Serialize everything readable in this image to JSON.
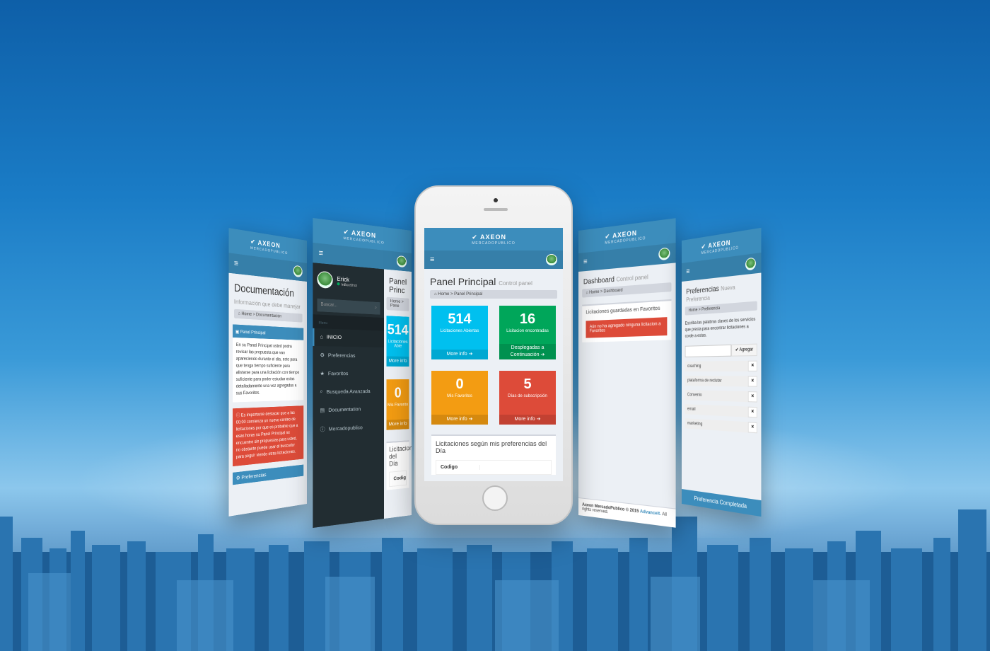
{
  "brand": {
    "name": "AXEON",
    "sub": "MERCADOPUBLICO"
  },
  "colors": {
    "primary": "#3c8dbc",
    "aqua": "#00c0ef",
    "green": "#00a65a",
    "orange": "#f39c12",
    "red": "#dd4b39",
    "sidebar": "#222d32"
  },
  "center": {
    "title": "Panel Principal",
    "subtitle": "Control panel",
    "breadcrumb": [
      "Home",
      "Panel Principal"
    ],
    "tiles": [
      {
        "value": "514",
        "label": "Licitaciones Abiertas",
        "more": "More info"
      },
      {
        "value": "16",
        "label": "Licitacion encontradas",
        "more": "Desplegadas a Continuación"
      },
      {
        "value": "0",
        "label": "Mis Favoritos",
        "more": "More info"
      },
      {
        "value": "5",
        "label": "Días de subscripción",
        "more": "More info"
      }
    ],
    "box_title": "Licitaciones según mis preferencias del Día",
    "table_header": "Codigo"
  },
  "doc": {
    "title": "Documentación",
    "subtitle": "Información que debe manejar",
    "breadcrumb": [
      "Home",
      "Documentación"
    ],
    "box_header": "Panel Principal",
    "box_text": "En su Panel Principal usted podrá revisar las propuesta que van apareciendo durante el día, esto para que tenga tiempo suficiente para alistarse para una licitación con tiempo suficiente para poder estudiar estas detalladamente una vez agregadas a sus Favoritos.",
    "alert_text": "Es importante destacar que a las 00:00 comienza un nuevo conteo de licitaciones por que es probable que a esas horas su Panel Principal se encuentre sin propuestas para usted, no obstante puede usar el buscador para seguir viendo otras licitaciones.",
    "pref_bar": "Preferencias"
  },
  "menu": {
    "user": "Erick",
    "status": "InBoxShot",
    "search_placeholder": "Buscar...",
    "header": "Menu",
    "items": [
      "INICIO",
      "Preferencias",
      "Favoritos",
      "Busqueda Avanzada",
      "Documentation",
      "Mercadopublico"
    ],
    "peek_title": "Panel Princ",
    "peek_crumb": [
      "Home",
      "Pane"
    ],
    "peek_tile1": "514",
    "peek_tile1_label": "Licitaciones Abie",
    "peek_more": "More info",
    "peek_tile2": "0",
    "peek_tile2_label": "Mis Favorito",
    "peek_box": "Licitaciones del Día",
    "peek_code": "Codig"
  },
  "dash": {
    "title": "Dashboard",
    "subtitle": "Control panel",
    "breadcrumb": [
      "Home",
      "Dashboard"
    ],
    "box_title": "Licitaciones guardadas en Favoritos",
    "alert": "Aún no ha agregado ninguna licitacion a Favoritos",
    "footer_brand": "Axeon MercadoPublico © 2015",
    "footer_link": "Advanceit.",
    "footer_rest": "All rights reserved."
  },
  "pref": {
    "title": "Preferencias",
    "subtitle": "Nueva Preferencia",
    "breadcrumb": [
      "Home",
      "Preferencia"
    ],
    "text": "Escriba las palabras claves de los servicios que presta para encontrar licitaciones a corde a estas.",
    "add_label": "Agregar",
    "keywords": [
      "coaching",
      "plataforma de reclutar",
      "Convenio",
      "email",
      "marketing"
    ],
    "done": "Preferencia Completada"
  }
}
